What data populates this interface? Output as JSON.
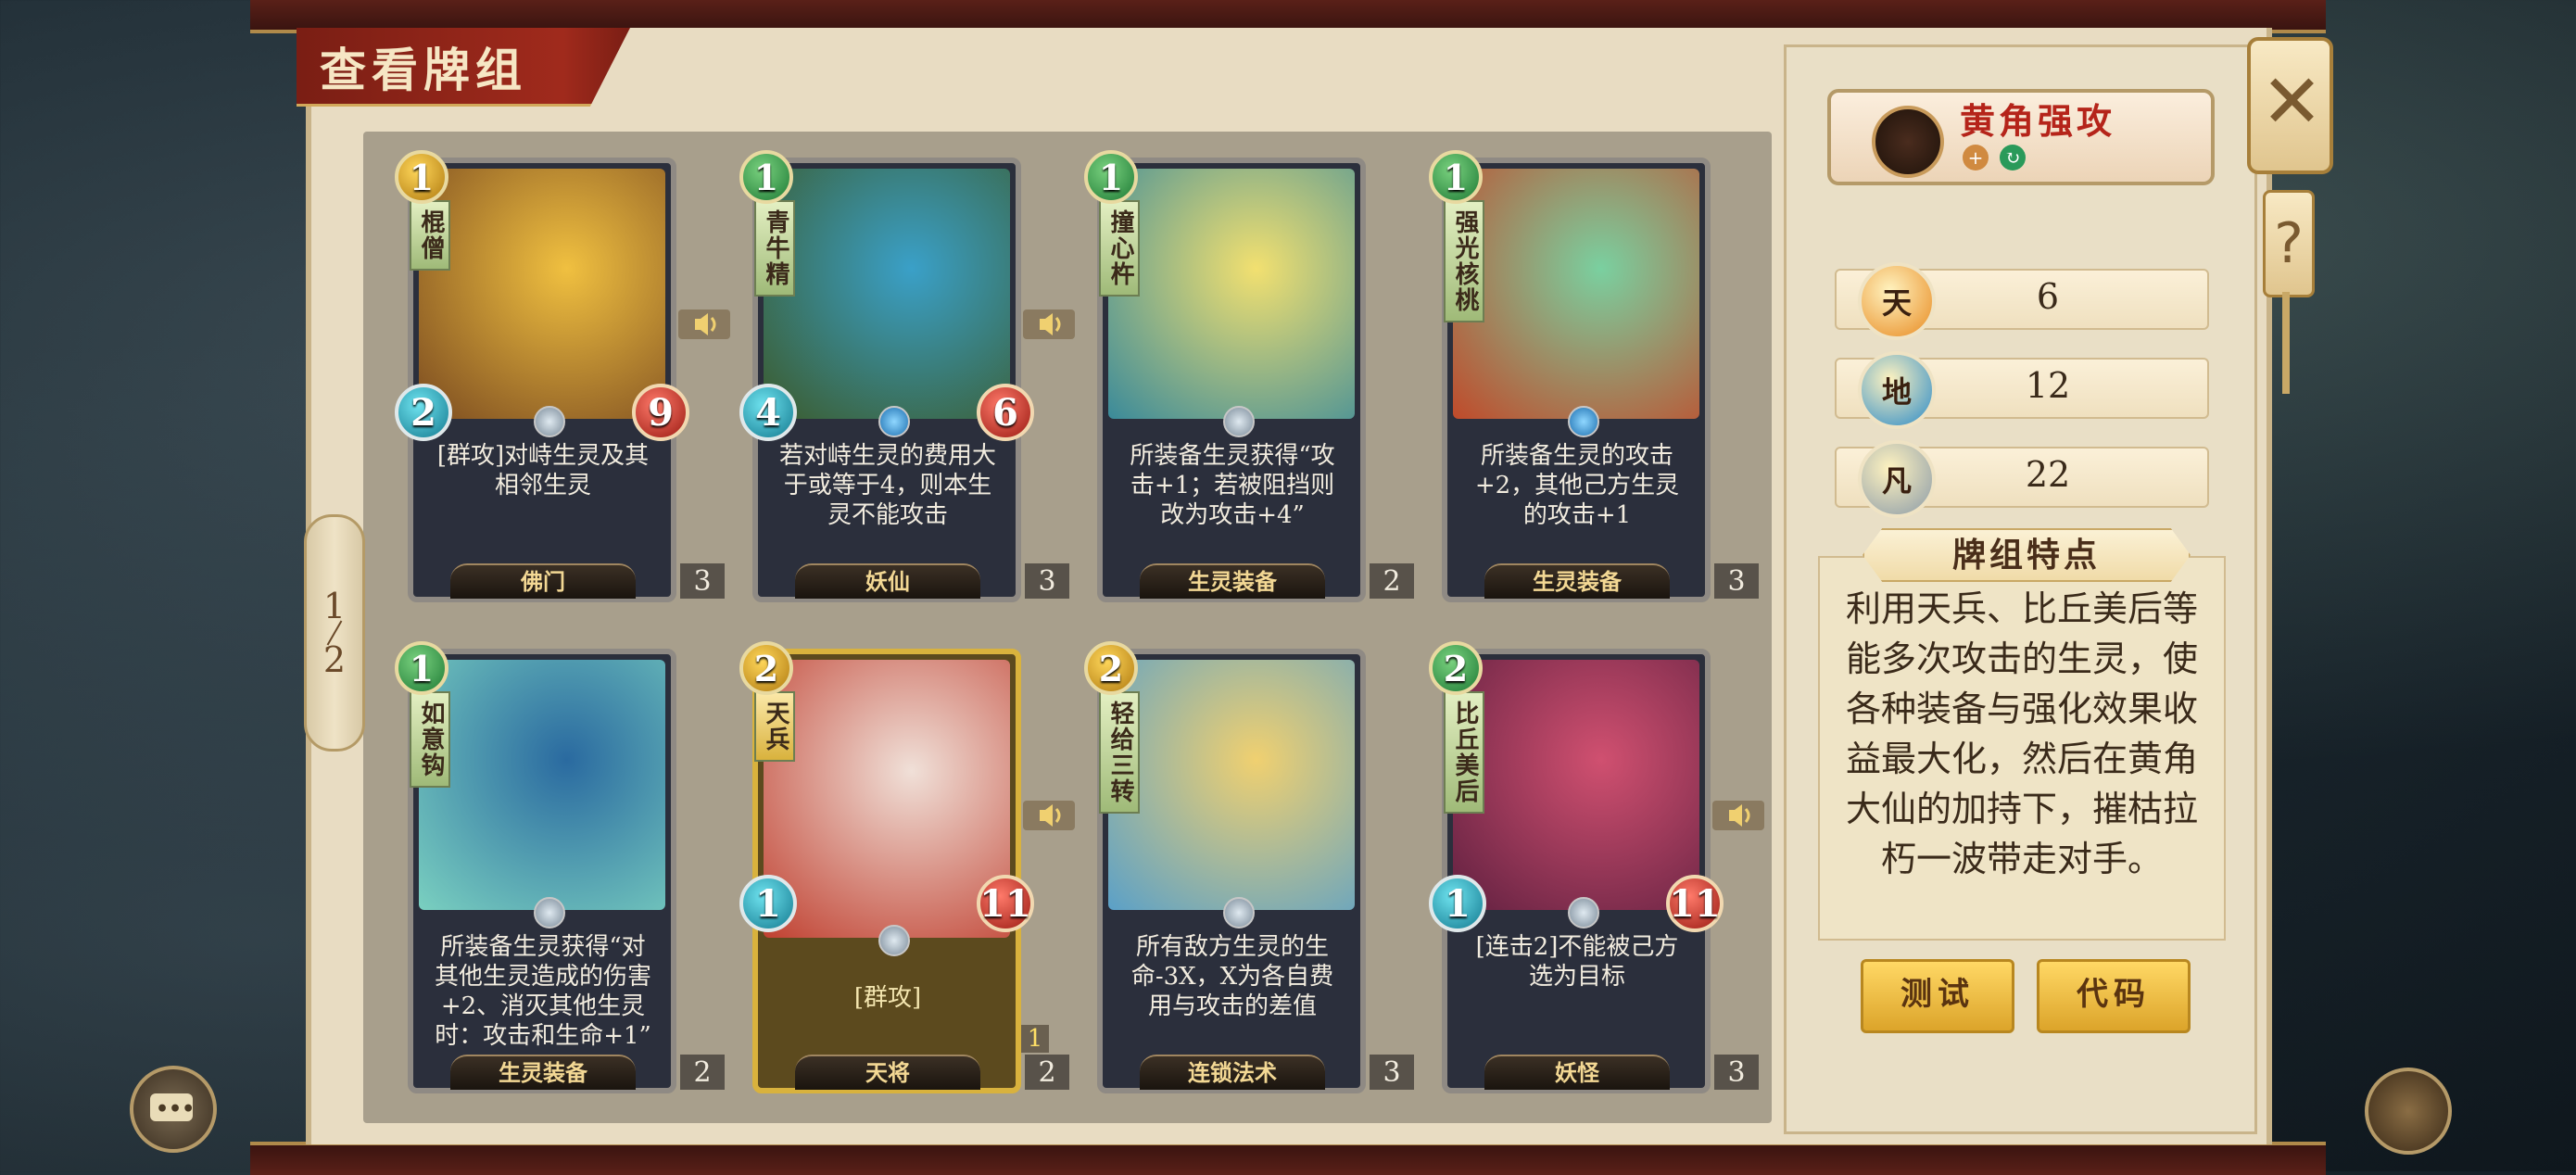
{
  "header": {
    "title": "查看牌组"
  },
  "pager": {
    "current": "1",
    "total": "2"
  },
  "cards": [
    {
      "name": "棍僧",
      "cost": "1",
      "cost_color": "gold",
      "attack": "2",
      "health": "9",
      "text": "[群攻]对峙生灵及其相邻生灵",
      "tribe": "佛门",
      "count": "3",
      "art_colors": [
        "#f0c040",
        "#7a4a20"
      ]
    },
    {
      "name": "青牛精",
      "cost": "1",
      "cost_color": "green",
      "attack": "4",
      "health": "6",
      "text": "若对峙生灵的费用大于或等于4，则本生灵不能攻击",
      "tribe": "妖仙",
      "count": "3",
      "art_colors": [
        "#3aa0c8",
        "#3b5a2a"
      ]
    },
    {
      "name": "撞心杵",
      "cost": "1",
      "cost_color": "green",
      "attack": "",
      "health": "",
      "text": "所装备生灵获得“攻击+1；若被阻挡则改为攻击+4”",
      "tribe": "生灵装备",
      "count": "2",
      "art_colors": [
        "#f2e070",
        "#3a8a9a"
      ]
    },
    {
      "name": "强光核桃",
      "cost": "1",
      "cost_color": "green",
      "attack": "",
      "health": "",
      "text": "所装备生灵的攻击+2，其他己方生灵的攻击+1",
      "tribe": "生灵装备",
      "count": "3",
      "art_colors": [
        "#7ad0a0",
        "#c04a2a"
      ]
    },
    {
      "name": "如意钩",
      "cost": "1",
      "cost_color": "green",
      "attack": "",
      "health": "",
      "text": "所装备生灵获得“对其他生灵造成的伤害+2、消灭其他生灵时：攻击和生命+1”",
      "tribe": "生灵装备",
      "count": "2",
      "art_colors": [
        "#2a6aa0",
        "#7ad0c0"
      ]
    },
    {
      "name": "天兵",
      "cost": "2",
      "cost_color": "gold",
      "attack": "1",
      "health": "11",
      "text": "[群攻]",
      "tribe": "天将",
      "count": "2",
      "extra": "1",
      "art_colors": [
        "#f0e0d8",
        "#c04030"
      ]
    },
    {
      "name": "轻给三转",
      "cost": "2",
      "cost_color": "gold",
      "attack": "",
      "health": "",
      "text": "所有敌方生灵的生命-3X，X为各自费用与攻击的差值",
      "tribe": "连锁法术",
      "count": "3",
      "art_colors": [
        "#f0d070",
        "#5aa0c8"
      ]
    },
    {
      "name": "比丘美后",
      "cost": "2",
      "cost_color": "green",
      "attack": "1",
      "health": "11",
      "text": "[连击2]不能被己方选为目标",
      "tribe": "妖怪",
      "count": "3",
      "art_colors": [
        "#d05070",
        "#602040"
      ]
    }
  ],
  "deck": {
    "name": "黄角强攻",
    "stats": [
      {
        "label": "天",
        "value": "6",
        "color": "#e88a20"
      },
      {
        "label": "地",
        "value": "12",
        "color": "#2a8ac8"
      },
      {
        "label": "凡",
        "value": "22",
        "color": "#8a9aa8"
      }
    ]
  },
  "features": {
    "title": "牌组特点",
    "text": "利用天兵、比丘美后等能多次攻击的生灵，使各种装备与强化效果收益最大化，然后在黄角大仙的加持下，摧枯拉朽一波带走对手。"
  },
  "buttons": {
    "test": "测试",
    "code": "代码"
  },
  "controls": {
    "close": "✕",
    "help": "?"
  }
}
